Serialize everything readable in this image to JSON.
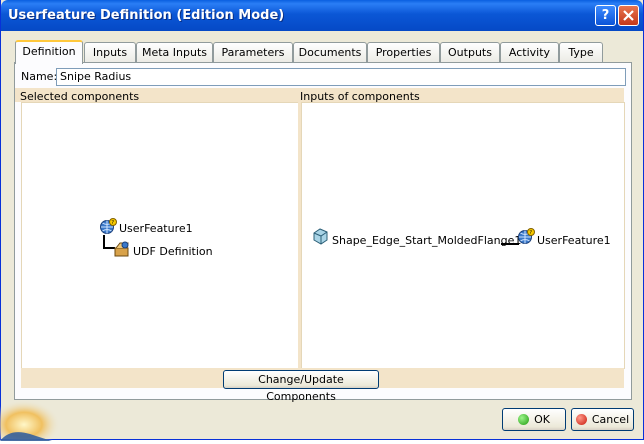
{
  "window": {
    "title": "Userfeature Definition (Edition Mode)"
  },
  "tabs": [
    "Definition",
    "Inputs",
    "Meta Inputs",
    "Parameters",
    "Documents",
    "Properties",
    "Outputs",
    "Activity",
    "Type"
  ],
  "name": {
    "label": "Name:",
    "value": "Snipe Radius"
  },
  "sections": {
    "selected": "Selected components",
    "inputs": "Inputs of components"
  },
  "tree": {
    "root": "UserFeature1",
    "child": "UDF Definition"
  },
  "graph": {
    "source": "Shape_Edge_Start_MoldedFlange1",
    "target": "UserFeature1"
  },
  "buttons": {
    "change": "Change/Update Components",
    "ok": "OK",
    "cancel": "Cancel"
  },
  "icons": {
    "help": "help-icon",
    "close": "close-icon"
  }
}
